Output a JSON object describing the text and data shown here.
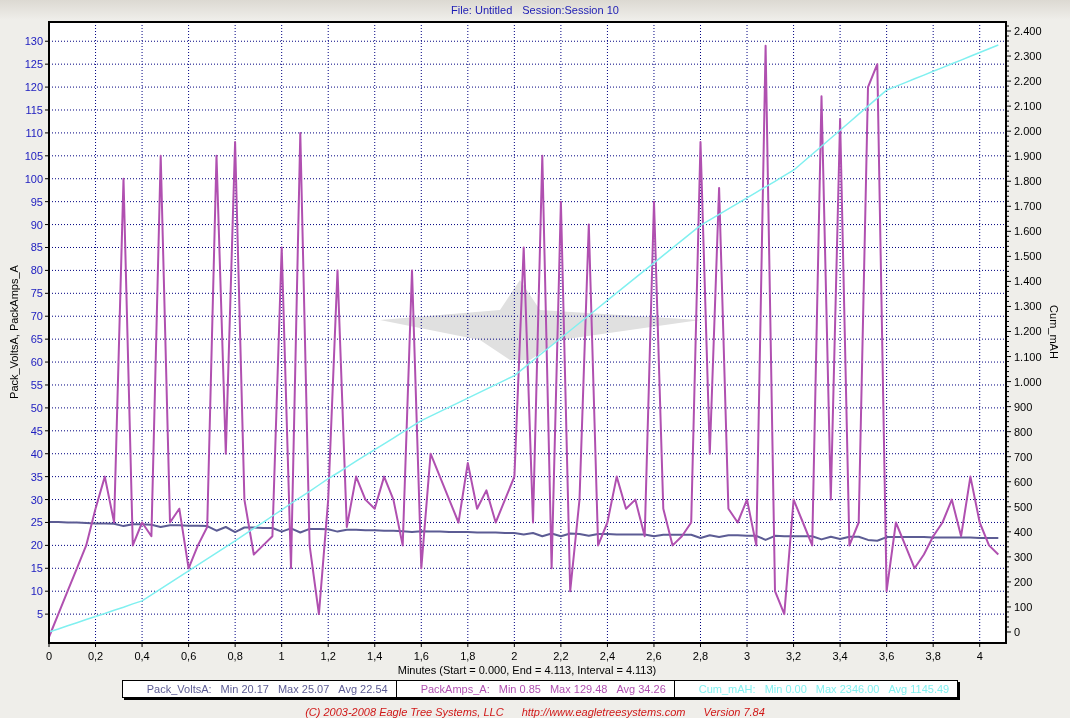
{
  "header": {
    "file": "File: Untitled",
    "session": "Session:Session 10"
  },
  "chart": {
    "chart_data": {
      "type": "line",
      "grid": true,
      "xlabel": "Minutes (Start = 0.000, End = 4.113, Interval = 4.113)",
      "ylabel": "Pack_VoltsA, PackAmps_A",
      "y2label": "Cum_mAH",
      "xlim": [
        0,
        4.113
      ],
      "ylim": [
        -1.3,
        134.2
      ],
      "y2lim": [
        -44,
        2436
      ],
      "xticks": [
        0,
        {
          "value": 0.2,
          "label": "0,2"
        },
        {
          "value": 0.4,
          "label": "0,4"
        },
        {
          "value": 0.6,
          "label": "0,6"
        },
        {
          "value": 0.8,
          "label": "0,8"
        },
        1,
        {
          "value": 1.2,
          "label": "1,2"
        },
        {
          "value": 1.4,
          "label": "1,4"
        },
        {
          "value": 1.6,
          "label": "1,6"
        },
        {
          "value": 1.8,
          "label": "1,8"
        },
        2,
        {
          "value": 2.2,
          "label": "2,2"
        },
        {
          "value": 2.4,
          "label": "2,4"
        },
        {
          "value": 2.6,
          "label": "2,6"
        },
        {
          "value": 2.8,
          "label": "2,8"
        },
        3,
        {
          "value": 3.2,
          "label": "3,2"
        },
        {
          "value": 3.4,
          "label": "3,4"
        },
        {
          "value": 3.6,
          "label": "3,6"
        },
        {
          "value": 3.8,
          "label": "3,8"
        },
        4
      ],
      "yticks": [
        5,
        10,
        15,
        20,
        25,
        30,
        35,
        40,
        45,
        50,
        55,
        60,
        65,
        70,
        75,
        80,
        85,
        90,
        95,
        100,
        105,
        110,
        115,
        120,
        125,
        130
      ],
      "y2ticks": [
        0,
        100,
        200,
        300,
        400,
        500,
        600,
        700,
        800,
        900,
        {
          "value": 1000,
          "label": "1.000"
        },
        {
          "value": 1100,
          "label": "1.100"
        },
        {
          "value": 1200,
          "label": "1.200"
        },
        {
          "value": 1300,
          "label": "1.300"
        },
        {
          "value": 1400,
          "label": "1.400"
        },
        {
          "value": 1500,
          "label": "1.500"
        },
        {
          "value": 1600,
          "label": "1.600"
        },
        {
          "value": 1700,
          "label": "1.700"
        },
        {
          "value": 1800,
          "label": "1.800"
        },
        {
          "value": 1900,
          "label": "1.900"
        },
        {
          "value": 2000,
          "label": "2.000"
        },
        {
          "value": 2100,
          "label": "2.100"
        },
        {
          "value": 2200,
          "label": "2.200"
        },
        {
          "value": 2300,
          "label": "2.300"
        },
        {
          "value": 2400,
          "label": "2.400"
        }
      ],
      "x": [
        0,
        0.04,
        0.08,
        0.12,
        0.16,
        0.2,
        0.24,
        0.28,
        0.32,
        0.36,
        0.4,
        0.44,
        0.48,
        0.52,
        0.56,
        0.6,
        0.64,
        0.68,
        0.72,
        0.76,
        0.8,
        0.84,
        0.88,
        0.92,
        0.96,
        1,
        1.04,
        1.08,
        1.12,
        1.16,
        1.2,
        1.24,
        1.28,
        1.32,
        1.36,
        1.4,
        1.44,
        1.48,
        1.52,
        1.56,
        1.6,
        1.64,
        1.68,
        1.72,
        1.76,
        1.8,
        1.84,
        1.88,
        1.92,
        1.96,
        2,
        2.04,
        2.08,
        2.12,
        2.16,
        2.2,
        2.24,
        2.28,
        2.32,
        2.36,
        2.4,
        2.44,
        2.48,
        2.52,
        2.56,
        2.6,
        2.64,
        2.68,
        2.72,
        2.76,
        2.8,
        2.84,
        2.88,
        2.92,
        2.96,
        3,
        3.04,
        3.08,
        3.12,
        3.16,
        3.2,
        3.24,
        3.28,
        3.32,
        3.36,
        3.4,
        3.44,
        3.48,
        3.52,
        3.56,
        3.6,
        3.64,
        3.68,
        3.72,
        3.76,
        3.8,
        3.84,
        3.88,
        3.92,
        3.96,
        4,
        4.04,
        4.08
      ],
      "series": [
        {
          "name": "Pack_VoltsA",
          "color": "#5c5c94",
          "values": [
            25.1,
            25.1,
            25.0,
            25.0,
            24.9,
            24.8,
            24.8,
            24.7,
            24.2,
            24.6,
            24.6,
            24.5,
            24.0,
            24.4,
            24.4,
            24.3,
            24.3,
            24.2,
            23.2,
            24.0,
            22.9,
            23.9,
            23.9,
            23.8,
            23.8,
            23.0,
            23.7,
            22.8,
            23.6,
            23.6,
            23.5,
            23.0,
            23.4,
            23.4,
            23.3,
            23.3,
            23.2,
            23.2,
            23.1,
            22.9,
            23.1,
            23.0,
            23.0,
            22.9,
            22.9,
            22.9,
            22.8,
            22.8,
            22.8,
            22.7,
            22.7,
            22.4,
            22.7,
            22.0,
            22.6,
            22.0,
            22.6,
            22.5,
            22.1,
            22.5,
            22.5,
            22.4,
            22.4,
            22.4,
            22.4,
            22.0,
            22.3,
            22.3,
            22.3,
            22.3,
            21.6,
            22.2,
            21.8,
            22.2,
            22.2,
            22.1,
            22.1,
            21.2,
            22.1,
            22.0,
            22.0,
            22.0,
            22.0,
            21.3,
            21.9,
            21.4,
            21.9,
            21.9,
            21.2,
            21.0,
            21.8,
            21.8,
            21.8,
            21.8,
            21.8,
            21.7,
            21.7,
            21.7,
            21.7,
            21.7,
            21.6,
            21.6,
            21.6
          ]
        },
        {
          "name": "PackAmps_A",
          "color": "#b050b0",
          "values": [
            0,
            5,
            10,
            15,
            20,
            28,
            35,
            25,
            100,
            20,
            25,
            22,
            105,
            25,
            28,
            15,
            20,
            24,
            105,
            40,
            108,
            30,
            18,
            20,
            22,
            85,
            15,
            110,
            20,
            5,
            30,
            80,
            24,
            35,
            30,
            28,
            35,
            30,
            20,
            80,
            15,
            40,
            35,
            30,
            25,
            38,
            28,
            32,
            25,
            30,
            35,
            85,
            25,
            105,
            15,
            95,
            10,
            30,
            90,
            20,
            25,
            35,
            28,
            30,
            22,
            95,
            28,
            20,
            22,
            25,
            108,
            40,
            98,
            28,
            25,
            30,
            20,
            129,
            10,
            5,
            30,
            25,
            20,
            118,
            30,
            113,
            20,
            25,
            120,
            125,
            10,
            25,
            20,
            15,
            18,
            22,
            25,
            30,
            22,
            35,
            25,
            20,
            18
          ]
        },
        {
          "name": "Cum_mAH",
          "color": "#80f0f0",
          "axis": "y2",
          "values": [
            0,
            12,
            25,
            37,
            50,
            62,
            74,
            87,
            99,
            112,
            124,
            148,
            172,
            196,
            220,
            244,
            268,
            292,
            316,
            340,
            364,
            389,
            414,
            438,
            463,
            488,
            513,
            538,
            562,
            587,
            612,
            635,
            658,
            682,
            705,
            728,
            751,
            774,
            798,
            821,
            844,
            862,
            880,
            898,
            916,
            934,
            952,
            970,
            988,
            1006,
            1024,
            1054,
            1084,
            1114,
            1144,
            1174,
            1204,
            1234,
            1264,
            1294,
            1324,
            1354,
            1384,
            1414,
            1444,
            1474,
            1504,
            1534,
            1564,
            1594,
            1624,
            1646,
            1668,
            1690,
            1712,
            1734,
            1756,
            1778,
            1800,
            1822,
            1844,
            1876,
            1908,
            1940,
            1972,
            2004,
            2036,
            2068,
            2100,
            2132,
            2164,
            2179,
            2194,
            2209,
            2224,
            2239,
            2254,
            2269,
            2284,
            2299,
            2314,
            2329,
            2344
          ]
        }
      ]
    }
  },
  "legend": [
    {
      "separator": ":",
      "min": "Min 20.17",
      "max": "Max 25.07",
      "avg": "Avg 22.54"
    },
    {
      "separator": ":",
      "min": "Min 0.85",
      "max": "Max 129.48",
      "avg": "Avg 34.26"
    },
    {
      "separator": ":",
      "min": "Min 0.00",
      "max": "Max 2346.00",
      "avg": "Avg 1145.49"
    }
  ],
  "footer": {
    "copyright": "(C) 2003-2008 Eagle Tree Systems, LLC",
    "url": "http://www.eagletreesystems.com",
    "version": "Version 7.84"
  }
}
